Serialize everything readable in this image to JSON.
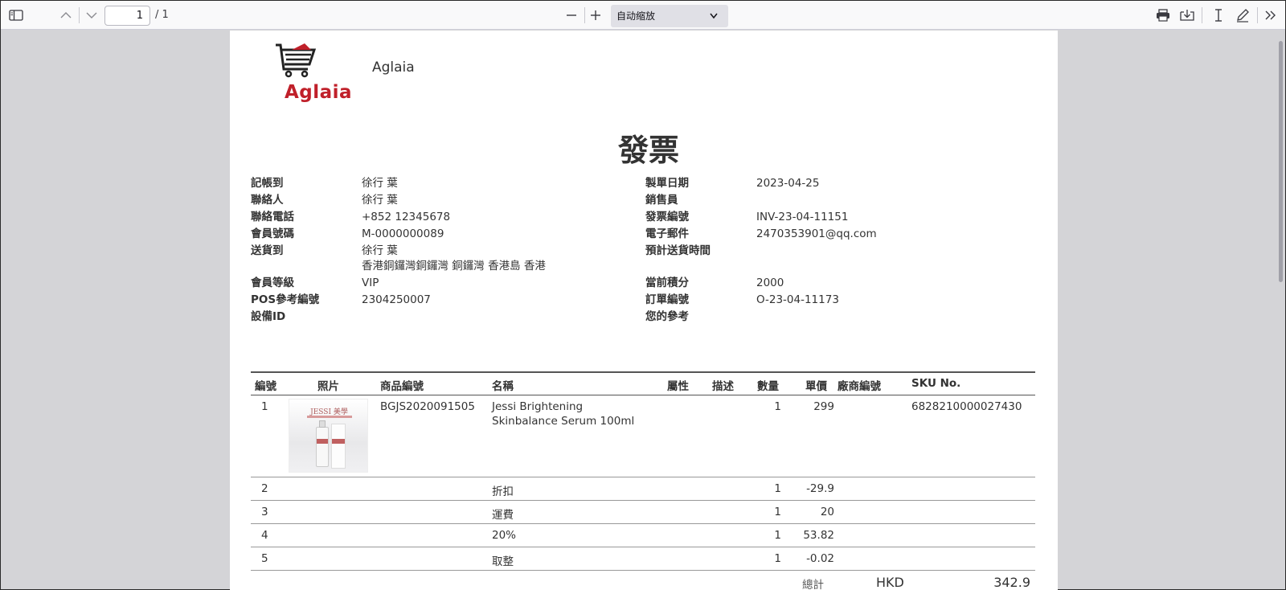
{
  "toolbar": {
    "page_current": "1",
    "page_total": "/ 1",
    "zoom_label": "自动缩放",
    "icons": [
      "sidebar-toggle-icon",
      "chevron-up-icon",
      "chevron-down-icon",
      "zoom-out-icon",
      "zoom-in-icon",
      "print-icon",
      "download-icon",
      "text-cursor-icon",
      "pen-icon",
      "double-chevron-right-icon"
    ]
  },
  "header": {
    "logo_text": "Aglaia",
    "company_name": "Aglaia",
    "title": "發票",
    "brand_color": "#c0202a"
  },
  "info_left": [
    {
      "label": "記帳到",
      "value": "徐行 葉",
      "value2": ""
    },
    {
      "label": "聯絡人",
      "value": "徐行 葉",
      "value2": ""
    },
    {
      "label": "聯絡電話",
      "value": "+852 12345678",
      "value2": ""
    },
    {
      "label": "會員號碼",
      "value": "M-0000000089",
      "value2": ""
    },
    {
      "label": "送貨到",
      "value": "徐行 葉",
      "value2": "香港銅鑼灣銅鑼灣 銅鑼灣 香港島 香港"
    },
    {
      "label": "會員等級",
      "value": "VIP",
      "value2": ""
    },
    {
      "label": "POS參考編號",
      "value": "2304250007",
      "value2": ""
    },
    {
      "label": "設備ID",
      "value": "",
      "value2": ""
    }
  ],
  "info_right": [
    {
      "label": "製單日期",
      "value": "2023-04-25"
    },
    {
      "label": "銷售員",
      "value": ""
    },
    {
      "label": "發票編號",
      "value": "INV-23-04-11151"
    },
    {
      "label": "電子郵件",
      "value": "2470353901@qq.com"
    },
    {
      "label": "預計送貨時間",
      "value": ""
    },
    {
      "label": "當前積分",
      "value": "2000"
    },
    {
      "label": "訂單編號",
      "value": "O-23-04-11173"
    },
    {
      "label": "您的參考",
      "value": ""
    }
  ],
  "table": {
    "headers": {
      "no": "編號",
      "photo": "照片",
      "product_code": "商品編號",
      "name": "名稱",
      "attribute": "屬性",
      "description": "描述",
      "qty": "數量",
      "unit_price": "單價",
      "vendor_code": "廠商編號",
      "sku": "SKU No."
    },
    "product_image": {
      "brand": "JESSI 美學"
    },
    "rows": [
      {
        "no": "1",
        "product_code": "BGJS2020091505",
        "name": "Jessi Brightening",
        "name2": "Skinbalance Serum 100ml",
        "qty": "1",
        "unit_price": "299",
        "sku": "6828210000027430"
      },
      {
        "no": "2",
        "product_code": "",
        "name": "折扣",
        "name2": "",
        "qty": "1",
        "unit_price": "-29.9",
        "sku": ""
      },
      {
        "no": "3",
        "product_code": "",
        "name": "運費",
        "name2": "",
        "qty": "1",
        "unit_price": "20",
        "sku": ""
      },
      {
        "no": "4",
        "product_code": "",
        "name": "20%",
        "name2": "",
        "qty": "1",
        "unit_price": "53.82",
        "sku": ""
      },
      {
        "no": "5",
        "product_code": "",
        "name": "取整",
        "name2": "",
        "qty": "1",
        "unit_price": "-0.02",
        "sku": ""
      }
    ],
    "total": {
      "label": "總計",
      "currency": "HKD",
      "amount": "342.9"
    }
  }
}
